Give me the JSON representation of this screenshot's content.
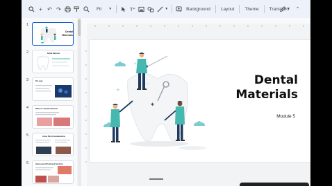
{
  "toolbar": {
    "zoom_label": "Fit",
    "background_label": "Background",
    "layout_label": "Layout",
    "theme_label": "Theme",
    "transition_label": "Transition"
  },
  "slides": [
    {
      "number": "1",
      "title": "Dental Materials"
    },
    {
      "number": "2",
      "title": "Dental Materials"
    },
    {
      "number": "3",
      "title": "Pre-reqs"
    },
    {
      "number": "4",
      "title": "What is a dental material?"
    },
    {
      "number": "5",
      "title": "Acute Pain Considerations"
    },
    {
      "number": "6",
      "title": "Impressions/Treatment Sections"
    }
  ],
  "current_slide": {
    "title_line1": "Dental",
    "title_line2": "Materials",
    "subtitle": "Module 5"
  },
  "colors": {
    "accent": "#0b57d0",
    "teal": "#44b8b1",
    "navy": "#1e3a5f"
  }
}
